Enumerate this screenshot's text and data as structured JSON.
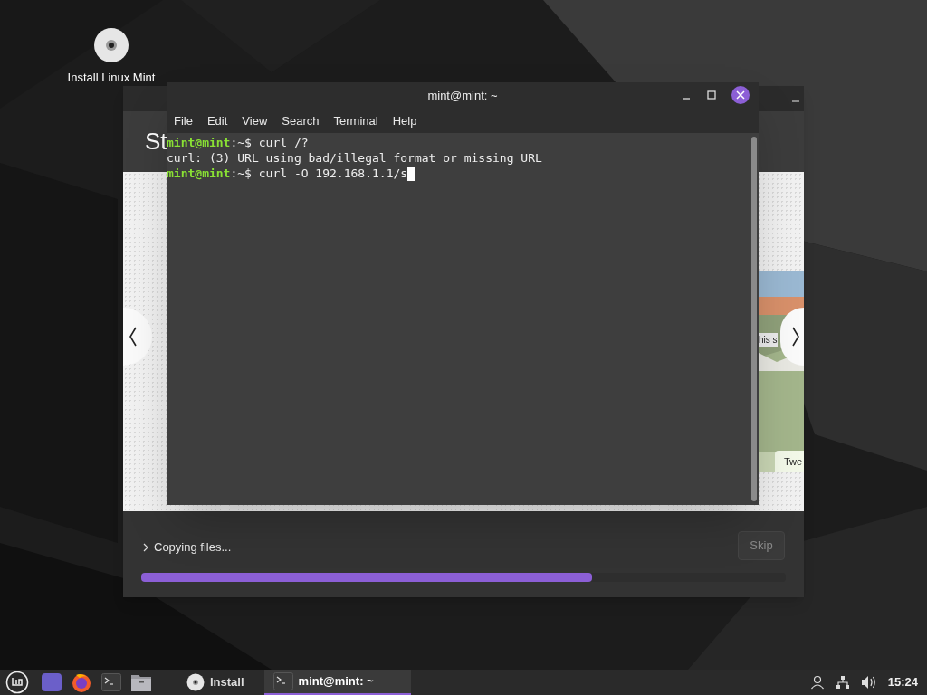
{
  "desktop_icons": [
    {
      "label": "Install Linux Mint"
    }
  ],
  "installer": {
    "header_title": "St",
    "slide": {
      "caption": "his s",
      "tag": "Twe"
    },
    "details": {
      "label": "Copying files...",
      "expanded": false
    },
    "skip_button": {
      "label": "Skip",
      "disabled": true
    },
    "progress": {
      "level": 0.7
    }
  },
  "terminal": {
    "title": "mint@mint: ~",
    "menu": [
      "File",
      "Edit",
      "View",
      "Search",
      "Terminal",
      "Help"
    ],
    "lines": [
      {
        "kind": "prompt",
        "user": "mint@mint",
        "text": ":~$ curl /?",
        "cursor": false
      },
      {
        "kind": "output",
        "text": "curl: (3) URL using bad/illegal format or missing URL"
      },
      {
        "kind": "prompt",
        "user": "mint@mint",
        "text": ":~$ curl -O 192.168.1.1/s",
        "cursor": true
      }
    ]
  },
  "taskbar": {
    "launchers": [
      {
        "kind": "desktop"
      },
      {
        "kind": "browser"
      },
      {
        "kind": "terminal"
      },
      {
        "kind": "files"
      }
    ],
    "windows": [
      {
        "kind": "disc",
        "label": "Install",
        "selected": false
      },
      {
        "kind": "terminal",
        "label": "mint@mint: ~",
        "selected": true
      }
    ],
    "clock": "15:24"
  }
}
